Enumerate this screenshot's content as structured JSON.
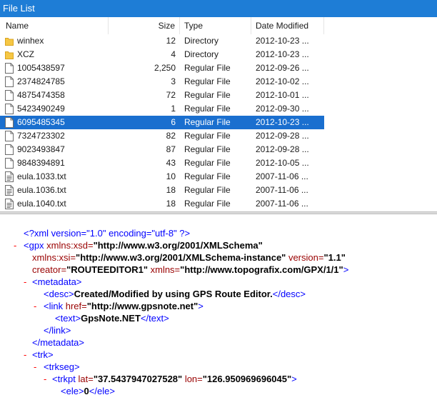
{
  "window": {
    "title": "File List"
  },
  "columns": {
    "name": "Name",
    "size": "Size",
    "type": "Type",
    "date": "Date Modified"
  },
  "files": [
    {
      "name": "winhex",
      "size": "12",
      "type": "Directory",
      "date": "2012-10-23 ...",
      "icon": "folder-icon"
    },
    {
      "name": "XCZ",
      "size": "4",
      "type": "Directory",
      "date": "2012-10-23 ...",
      "icon": "folder-icon"
    },
    {
      "name": "1005438597",
      "size": "2,250",
      "type": "Regular File",
      "date": "2012-09-26 ...",
      "icon": "file-icon"
    },
    {
      "name": "2374824785",
      "size": "3",
      "type": "Regular File",
      "date": "2012-10-02 ...",
      "icon": "file-icon"
    },
    {
      "name": "4875474358",
      "size": "72",
      "type": "Regular File",
      "date": "2012-10-01 ...",
      "icon": "file-icon"
    },
    {
      "name": "5423490249",
      "size": "1",
      "type": "Regular File",
      "date": "2012-09-30 ...",
      "icon": "file-icon"
    },
    {
      "name": "6095485345",
      "size": "6",
      "type": "Regular File",
      "date": "2012-10-23 ...",
      "icon": "file-icon",
      "selected": true
    },
    {
      "name": "7324723302",
      "size": "82",
      "type": "Regular File",
      "date": "2012-09-28 ...",
      "icon": "file-icon"
    },
    {
      "name": "9023493847",
      "size": "87",
      "type": "Regular File",
      "date": "2012-09-28 ...",
      "icon": "file-icon"
    },
    {
      "name": "9848394891",
      "size": "43",
      "type": "Regular File",
      "date": "2012-10-05 ...",
      "icon": "file-icon"
    },
    {
      "name": "eula.1033.txt",
      "size": "10",
      "type": "Regular File",
      "date": "2007-11-06 ...",
      "icon": "text-file-icon"
    },
    {
      "name": "eula.1036.txt",
      "size": "18",
      "type": "Regular File",
      "date": "2007-11-06 ...",
      "icon": "text-file-icon"
    },
    {
      "name": "eula.1040.txt",
      "size": "18",
      "type": "Regular File",
      "date": "2007-11-06 ...",
      "icon": "text-file-icon"
    }
  ],
  "xml": {
    "decl": "<?xml version=\"1.0\" encoding=\"utf-8\" ?>",
    "collapse_symbol": "-",
    "gpx_open": "<gpx",
    "attr_xsd": " xmlns:xsd=",
    "val_xsd": "\"http://www.w3.org/2001/XMLSchema\"",
    "attr_xsi": "xmlns:xsi=",
    "val_xsi": "\"http://www.w3.org/2001/XMLSchema-instance\"",
    "attr_version": " version=",
    "val_version": "\"1.1\"",
    "attr_creator": "creator=",
    "val_creator": "\"ROUTEEDITOR1\"",
    "attr_xmlns": " xmlns=",
    "val_xmlns": "\"http://www.topografix.com/GPX/1/1\"",
    "gt": ">",
    "metadata_open": "<metadata>",
    "desc_open": "<desc>",
    "desc_text": "Created/Modified by using GPS Route Editor.",
    "desc_close": "</desc>",
    "link_open": "<link",
    "attr_href": " href=",
    "val_href": "\"http://www.gpsnote.net\"",
    "text_open": "<text>",
    "text_value": "GpsNote.NET",
    "text_close": "</text>",
    "link_close": "</link>",
    "metadata_close": "</metadata>",
    "trk_open": "<trk>",
    "trkseg_open": "<trkseg>",
    "trkpt_open": "<trkpt",
    "attr_lat": " lat=",
    "val_lat": "\"37.5437947027528\"",
    "attr_lon": " lon=",
    "val_lon": "\"126.950969696045\"",
    "ele_open": "<ele>",
    "ele_value": "0",
    "ele_close": "</ele>"
  }
}
